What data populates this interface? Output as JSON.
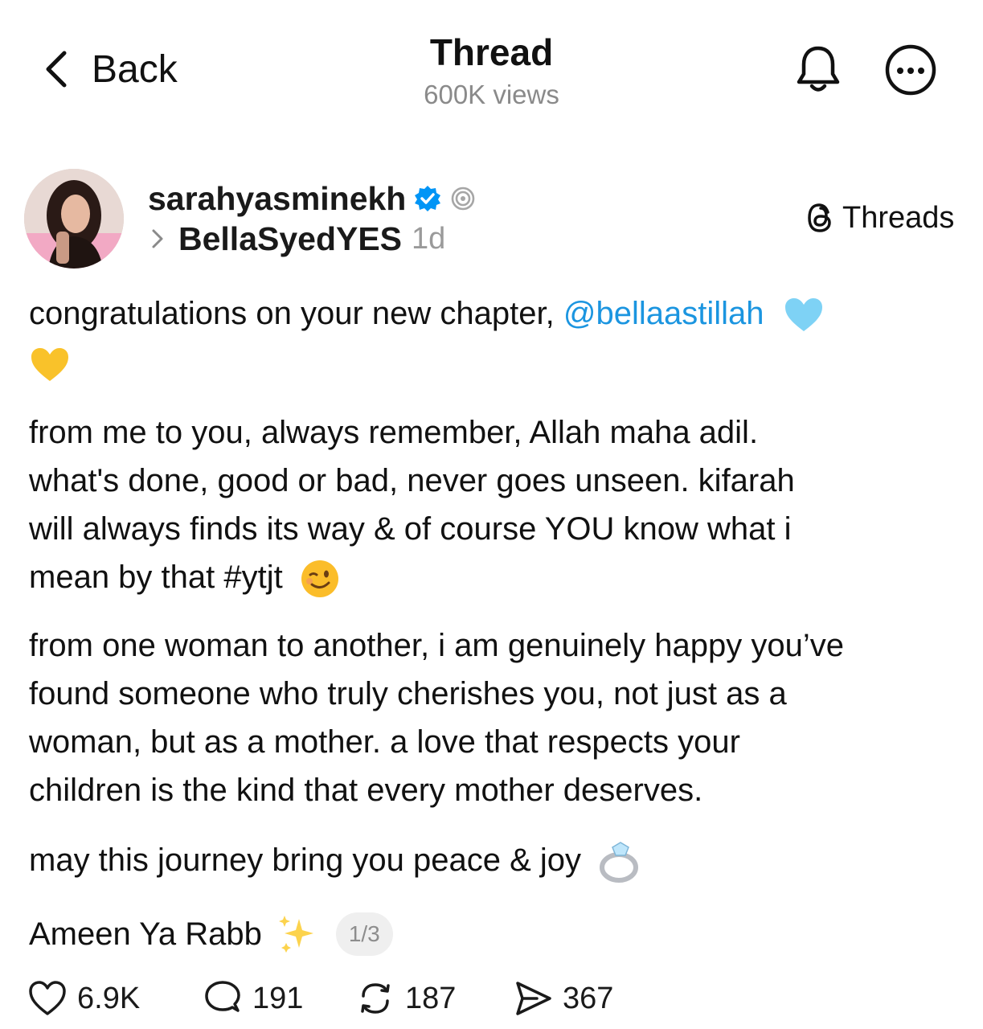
{
  "header": {
    "back_label": "Back",
    "title": "Thread",
    "subtitle": "600K views"
  },
  "author": {
    "username": "sarahyasminekh",
    "reply_to": "BellaSyedYES",
    "time": "1d",
    "source_label": "Threads"
  },
  "post": {
    "p1_prefix": "congratulations on your new chapter, ",
    "p1_mention": "@bellaastillah",
    "p2_line1": "from me to you, always remember, Allah maha adil.",
    "p2_line2": "what's done, good or bad, never goes unseen. kifarah",
    "p2_line3": "will always finds its way & of course YOU know what i",
    "p2_line4": "mean by that #ytjt",
    "p3_line1": "from one woman to another, i am genuinely happy you’ve",
    "p3_line2": "found someone who truly cherishes you, not just as a",
    "p3_line3": "woman, but as a mother. a love that respects your",
    "p3_line4": "children is the kind that every mother deserves.",
    "p4": "may this journey bring you peace & joy",
    "p5": "Ameen Ya Rabb",
    "page_indicator": "1/3"
  },
  "actions": {
    "likes": "6.9K",
    "replies": "191",
    "reposts": "187",
    "shares": "367"
  },
  "colors": {
    "mention": "#1b95e0",
    "verified": "#0095f6",
    "muted": "#8a8a8a"
  },
  "icons": [
    "back-chevron-icon",
    "bell-icon",
    "more-options-icon",
    "verified-badge-icon",
    "aura-icon",
    "threads-logo-icon",
    "heart-icon",
    "comment-icon",
    "repost-icon",
    "share-icon"
  ]
}
